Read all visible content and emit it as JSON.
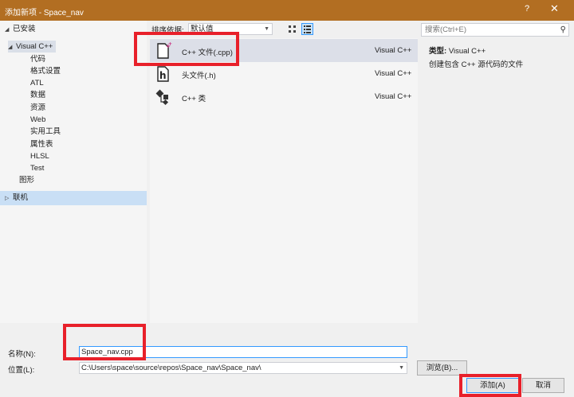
{
  "window": {
    "title": "添加新项 - Space_nav",
    "help": "?",
    "close": "✕"
  },
  "tree": {
    "installed": "已安装",
    "visual_cpp": "Visual C++",
    "children": [
      "代码",
      "格式设置",
      "ATL",
      "数据",
      "资源",
      "Web",
      "实用工具",
      "属性表",
      "HLSL",
      "Test"
    ],
    "graphics": "图形",
    "online": "联机"
  },
  "toolbar": {
    "sort_label": "排序依据:",
    "sort_value": "默认值"
  },
  "search": {
    "placeholder": "搜索(Ctrl+E)"
  },
  "templates": [
    {
      "name": "C++ 文件(.cpp)",
      "lang": "Visual C++"
    },
    {
      "name": "头文件(.h)",
      "lang": "Visual C++"
    },
    {
      "name": "C++ 类",
      "lang": "Visual C++"
    }
  ],
  "details": {
    "type_label": "类型:",
    "type_value": "Visual C++",
    "description": "创建包含 C++ 源代码的文件"
  },
  "form": {
    "name_label": "名称(N):",
    "name_value": "Space_nav.cpp",
    "location_label": "位置(L):",
    "location_value": "C:\\Users\\space\\source\\repos\\Space_nav\\Space_nav\\"
  },
  "buttons": {
    "browse": "浏览(B)...",
    "add": "添加(A)",
    "cancel": "取消"
  },
  "colors": {
    "titlebar": "#b26e22",
    "selection": "#dcdfe8",
    "highlight": "#e8202a",
    "accent": "#3399ff"
  }
}
